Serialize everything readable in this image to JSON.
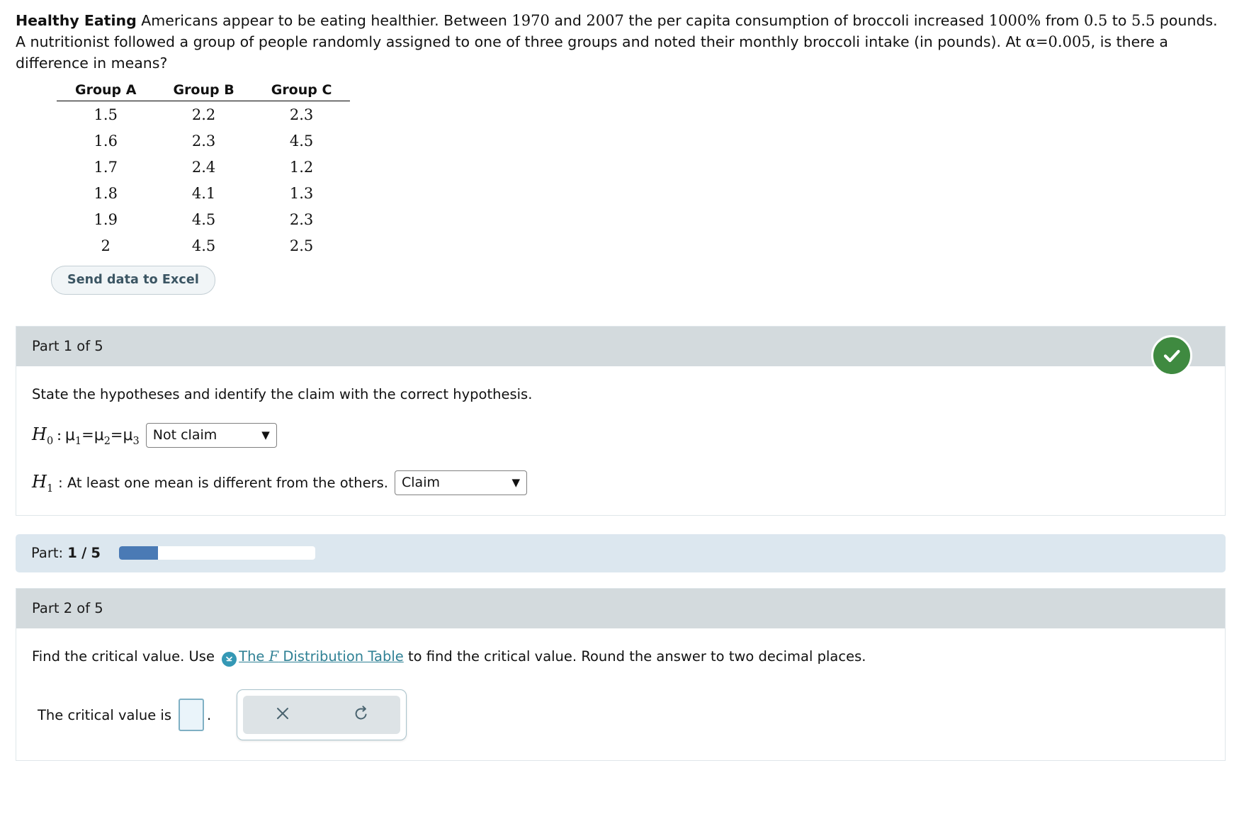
{
  "problem": {
    "title": "Healthy Eating",
    "text_part1": " Americans appear to be eating healthier. Between ",
    "year_start": "1970",
    "text_and": " and ",
    "year_end": "2007",
    "text_part2": " the per capita consumption of broccoli increased ",
    "percent": "1000%",
    "text_from": " from ",
    "value_from": "0.5",
    "text_to": " to ",
    "value_to": "5.5",
    "text_part3": " pounds. A nutritionist followed a group of people randomly assigned to one of three groups and noted their monthly broccoli intake (in pounds). At ",
    "alpha": "α=0.005",
    "text_part4": ", is there a difference in means?"
  },
  "table": {
    "headers": [
      "Group A",
      "Group B",
      "Group C"
    ],
    "rows": [
      [
        "1.5",
        "2.2",
        "2.3"
      ],
      [
        "1.6",
        "2.3",
        "4.5"
      ],
      [
        "1.7",
        "2.4",
        "1.2"
      ],
      [
        "1.8",
        "4.1",
        "1.3"
      ],
      [
        "1.9",
        "4.5",
        "2.3"
      ],
      [
        "2",
        "4.5",
        "2.5"
      ]
    ]
  },
  "excel_button": {
    "label": "Send data to Excel"
  },
  "part1": {
    "header": "Part 1 of 5",
    "question": "State the hypotheses and identify the claim with the correct hypothesis.",
    "h0": {
      "symbol": "H",
      "sub": "0",
      "colon": ":",
      "mu1": "μ",
      "s1": "1",
      "eq1": "=",
      "mu2": "μ",
      "s2": "2",
      "eq2": "=",
      "mu3": "μ",
      "s3": "3"
    },
    "h0_select": {
      "value": "Not claim",
      "caret": "▼"
    },
    "h1": {
      "symbol": "H",
      "sub": "1",
      "text": ": At least one mean is different from the others."
    },
    "h1_select": {
      "value": "Claim",
      "caret": "▼"
    },
    "status_icon": "check-icon"
  },
  "progress": {
    "label_prefix": "Part:",
    "current": "1",
    "separator": "/",
    "total": "5",
    "percent": 20,
    "fill_color": "#4a7ab5",
    "background_color": "#dce7ef"
  },
  "part2": {
    "header": "Part 2 of 5",
    "question_prefix": "Find the critical value. Use",
    "link_icon": "chevron-down-circle-icon",
    "link_text_before": "The ",
    "link_text_italic": "F",
    "link_text_after": " Distribution Table",
    "question_suffix": "to find the critical value. Round the answer to two decimal places.",
    "answer_label": "The critical value is",
    "answer_value": "",
    "period": ".",
    "toolbar": {
      "clear_icon": "close-x-icon",
      "undo_icon": "undo-arrow-icon"
    }
  },
  "colors": {
    "header_band": "#d3dadd",
    "check_green": "#3f8a40",
    "link_teal": "#2e8094",
    "accent_blue": "#4a7ab5"
  }
}
